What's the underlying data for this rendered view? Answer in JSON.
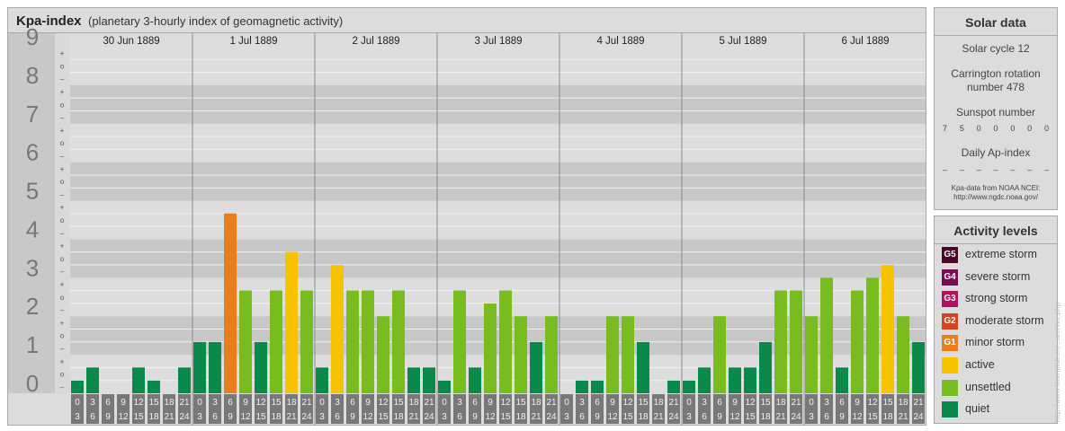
{
  "header": {
    "title": "Kpa-index",
    "subtitle": "(planetary 3-hourly index of geomagnetic activity)"
  },
  "chart_data": {
    "type": "bar",
    "title": "Kpa-index",
    "subtitle": "(planetary 3-hourly index of geomagnetic activity)",
    "ylim": [
      0,
      9
    ],
    "y_ticks": [
      "0",
      "1",
      "2",
      "3",
      "4",
      "5",
      "6",
      "7",
      "8",
      "9"
    ],
    "minor_ticks": [
      "–",
      "o",
      "+"
    ],
    "days": [
      "30 Jun 1889",
      "1 Jul 1889",
      "2 Jul 1889",
      "3 Jul 1889",
      "4 Jul 1889",
      "5 Jul 1889",
      "6 Jul 1889"
    ],
    "interval_top": [
      "0",
      "3",
      "6",
      "9",
      "12",
      "15",
      "18",
      "21"
    ],
    "interval_bottom": [
      "3",
      "6",
      "9",
      "12",
      "15",
      "18",
      "21",
      "24"
    ],
    "values": [
      [
        0.33,
        0.67,
        0,
        0,
        0.67,
        0.33,
        0,
        0.67
      ],
      [
        1.33,
        1.33,
        4.67,
        2.67,
        1.33,
        2.67,
        3.67,
        2.67
      ],
      [
        0.67,
        3.33,
        2.67,
        2.67,
        2,
        2.67,
        0.67,
        0.67
      ],
      [
        0.33,
        2.67,
        0.67,
        2.33,
        2.67,
        2,
        1.33,
        2
      ],
      [
        0,
        0.33,
        0.33,
        2,
        2,
        1.33,
        0,
        0.33
      ],
      [
        0.33,
        0.67,
        2,
        0.67,
        0.67,
        1.33,
        2.67,
        2.67
      ],
      [
        2,
        3,
        0.67,
        2.67,
        3,
        3.33,
        2,
        1.33
      ]
    ],
    "level_colors": {
      "quiet": "#0a8a4a",
      "unsettled": "#78bc20",
      "active": "#f7c200",
      "G1": "#e87d1e",
      "G2": "#d2451e",
      "G3": "#b0135e",
      "G4": "#7a0a52",
      "G5": "#4a0626"
    }
  },
  "solar": {
    "header": "Solar data",
    "cycle": "Solar cycle 12",
    "rotation": "Carrington rotation number 478",
    "sunspot_label": "Sunspot number",
    "sunspots": [
      "7",
      "5",
      "0",
      "0",
      "0",
      "0",
      "0"
    ],
    "ap_label": "Daily Ap-index",
    "ap": [
      "–",
      "–",
      "–",
      "–",
      "–",
      "–",
      "–"
    ],
    "credit_1": "Kpa-data from NOAA NCEI:",
    "credit_2": "http://www.ngdc.noaa.gov/"
  },
  "levels": {
    "header": "Activity levels",
    "items": [
      {
        "code": "G5",
        "label": "extreme storm",
        "color": "#4a0626"
      },
      {
        "code": "G4",
        "label": "severe storm",
        "color": "#7a0a52"
      },
      {
        "code": "G3",
        "label": "strong storm",
        "color": "#b0135e"
      },
      {
        "code": "G2",
        "label": "moderate storm",
        "color": "#d2451e"
      },
      {
        "code": "G1",
        "label": "minor storm",
        "color": "#e87d1e"
      },
      {
        "code": "",
        "label": "active",
        "color": "#f7c200"
      },
      {
        "code": "",
        "label": "unsettled",
        "color": "#78bc20"
      },
      {
        "code": "",
        "label": "quiet",
        "color": "#0a8a4a"
      }
    ]
  },
  "watermark": "http://www.fourmilab.ch/...archive.php"
}
